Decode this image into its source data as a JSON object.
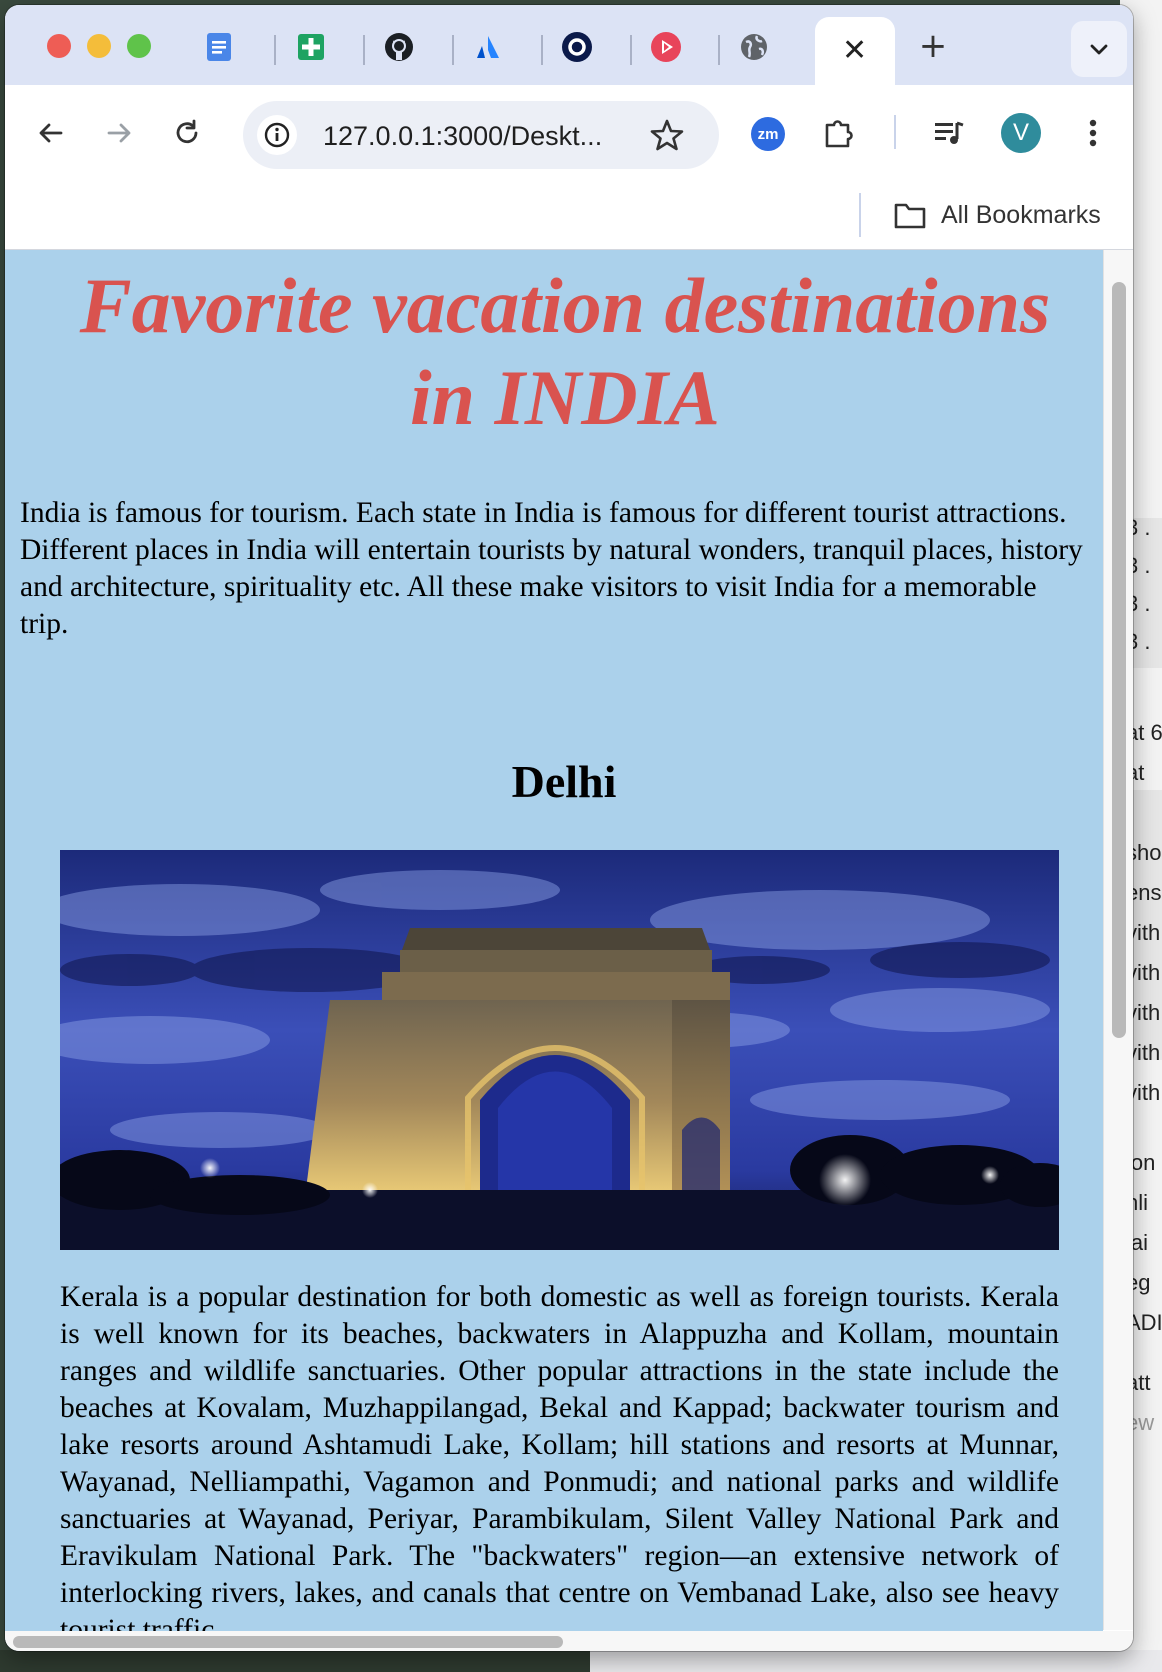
{
  "browser": {
    "tabs": [
      {
        "icon": "google-docs-icon"
      },
      {
        "icon": "google-sheets-icon"
      },
      {
        "icon": "github-icon"
      },
      {
        "icon": "atlassian-icon"
      },
      {
        "icon": "circle-app-icon"
      },
      {
        "icon": "video-play-icon"
      },
      {
        "icon": "globe-icon"
      },
      {
        "icon": "close-icon",
        "active": true
      }
    ],
    "new_tab_label": "+",
    "url": "127.0.0.1:3000/Deskt...",
    "zoom_extension_label": "zm",
    "avatar_initial": "V",
    "bookmarks": {
      "all_bookmarks_label": "All Bookmarks"
    }
  },
  "page": {
    "background_color": "#abd1eb",
    "title_color": "#d9534f",
    "title": "Favorite vacation destinations in INDIA",
    "intro": "India is famous for tourism. Each state in India is famous for different tourist attractions. Different places in India will entertain tourists by natural wonders, tranquil places, history and architecture, spirituality etc. All these make visitors to visit India for a memorable trip.",
    "section": {
      "heading": "Delhi",
      "image": "india-gate-photo",
      "body": "Kerala is a popular destination for both domestic as well as foreign tourists. Kerala is well known for its beaches, backwaters in Alappuzha and Kollam, mountain ranges and wildlife sanctuaries. Other popular attractions in the state include the beaches at Kovalam, Muzhappilangad, Bekal and Kappad; backwater tourism and lake resorts around Ashtamudi Lake, Kollam; hill stations and resorts at Munnar, Wayanad, Nelliampathi, Vagamon and Ponmudi; and national parks and wildlife sanctuaries at Wayanad, Periyar, Parambikulam, Silent Valley National Park and Eravikulam National Park. The \"backwaters\" region—an extensive network of interlocking rivers, lakes, and canals that centre on Vembanad Lake, also see heavy tourist traffic."
    }
  },
  "background_app": {
    "fragments": [
      "3 .",
      "3 .",
      "3 .",
      "3 .",
      "at 6",
      "at",
      "sho",
      "ens",
      "vith",
      "vith",
      "vith",
      "vith",
      "vith",
      "lon",
      "nli",
      "lai",
      "eg",
      "ADI",
      "att",
      "ew"
    ]
  }
}
